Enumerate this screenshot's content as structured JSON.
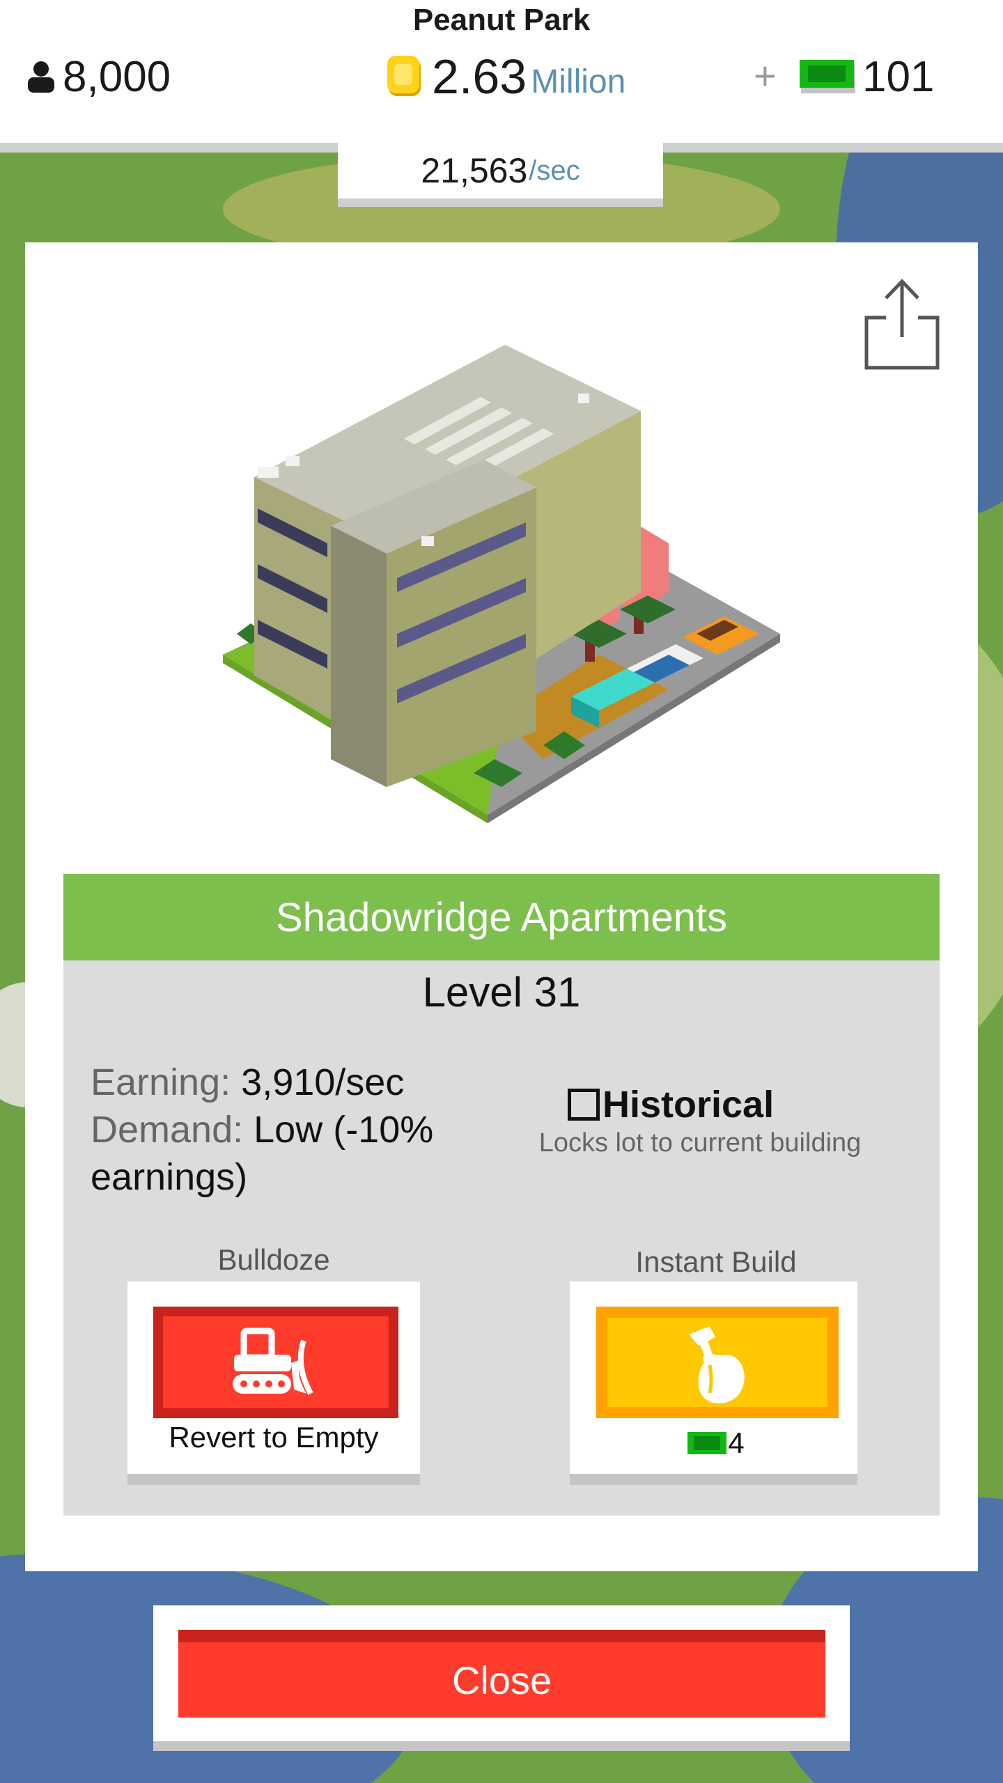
{
  "header": {
    "city_name": "Peanut Park",
    "population": "8,000",
    "money_value": "2.63",
    "money_unit": "Million",
    "plus": "+",
    "cash": "101",
    "rate_value": "21,563",
    "rate_unit": "/sec"
  },
  "building": {
    "name": "Shadowridge Apartments",
    "level": "Level 31",
    "earning_label": "Earning:",
    "earning_value": "3,910/sec",
    "demand_label": "Demand:",
    "demand_value": "Low (-10% earnings)",
    "historical_label": "Historical",
    "historical_checked": false,
    "historical_sub": "Locks lot to current building"
  },
  "actions": {
    "bulldoze_label": "Bulldoze",
    "bulldoze_caption": "Revert to Empty",
    "instant_label": "Instant Build",
    "instant_cost": "4"
  },
  "close_label": "Close",
  "icons": {
    "population": "person-icon",
    "money": "coin-icon",
    "cash": "cash-bill-icon",
    "share": "share-icon",
    "bulldoze": "bulldozer-icon",
    "instant": "hammer-hand-icon"
  },
  "colors": {
    "title_bar": "#7dbf4c",
    "bulldoze": "#ff3b2c",
    "instant": "#ffc800",
    "close": "#ff3b2c",
    "accent_text": "#5b8fb3"
  }
}
